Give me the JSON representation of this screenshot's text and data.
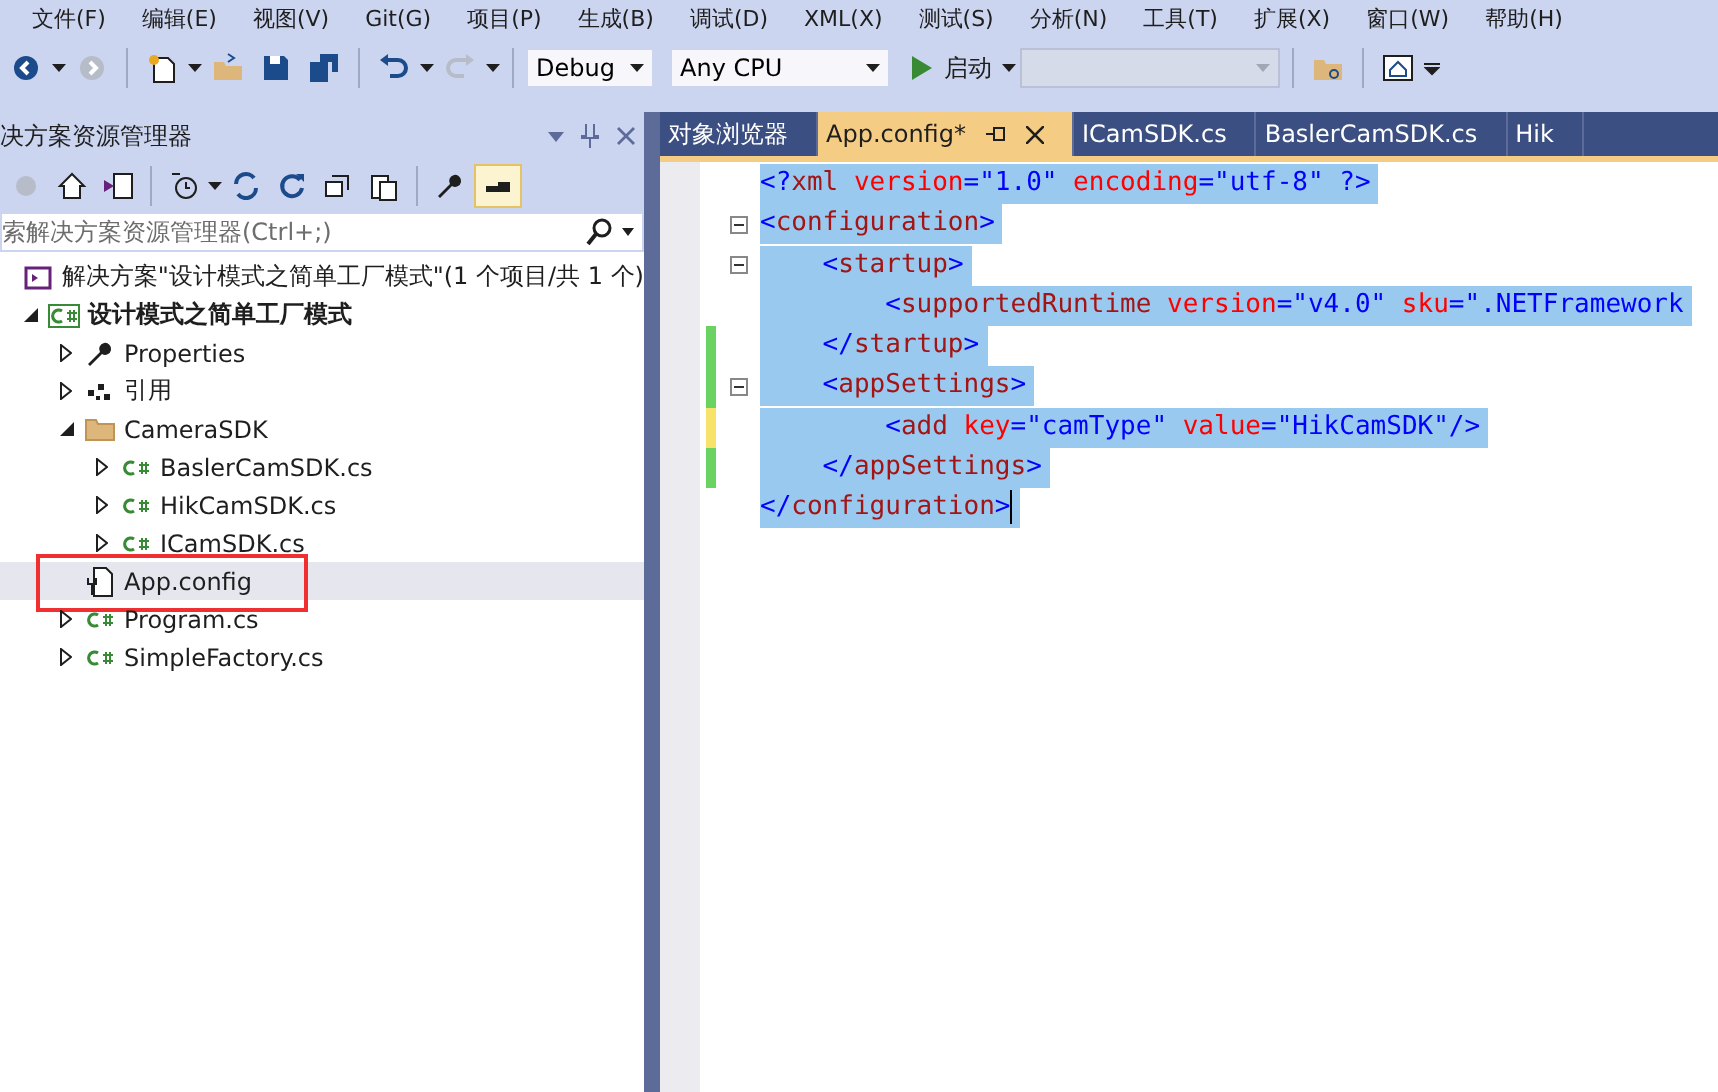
{
  "menu": [
    "文件(F)",
    "编辑(E)",
    "视图(V)",
    "Git(G)",
    "项目(P)",
    "生成(B)",
    "调试(D)",
    "XML(X)",
    "测试(S)",
    "分析(N)",
    "工具(T)",
    "扩展(X)",
    "窗口(W)",
    "帮助(H)"
  ],
  "toolbar": {
    "configuration": "Debug",
    "platform": "Any CPU",
    "start": "启动",
    "target": {
      "disabled": true
    }
  },
  "explorer": {
    "title": "决方案资源管理器",
    "search": {
      "placeholder": "索解决方案资源管理器(Ctrl+;)"
    },
    "tree": [
      {
        "label": "解决方案\"设计模式之简单工厂模式\"(1 个项目/共 1 个)",
        "kind": "solution",
        "selected": false,
        "children": [
          {
            "label": "设计模式之简单工厂模式",
            "kind": "project",
            "expanded": true,
            "selected": false,
            "children": [
              {
                "label": "Properties",
                "kind": "properties",
                "expanded": false,
                "selected": false
              },
              {
                "label": "引用",
                "kind": "references",
                "expanded": false,
                "selected": false
              },
              {
                "label": "CameraSDK",
                "kind": "folder",
                "expanded": true,
                "selected": false,
                "children": [
                  {
                    "label": "BaslerCamSDK.cs",
                    "kind": "cs",
                    "expanded": false,
                    "selected": false
                  },
                  {
                    "label": "HikCamSDK.cs",
                    "kind": "cs",
                    "expanded": false,
                    "selected": false
                  },
                  {
                    "label": "ICamSDK.cs",
                    "kind": "cs",
                    "expanded": false,
                    "selected": false
                  }
                ]
              },
              {
                "label": "App.config",
                "kind": "config",
                "selected": true,
                "highlighted": true
              },
              {
                "label": "Program.cs",
                "kind": "cs",
                "expanded": false,
                "selected": false
              },
              {
                "label": "SimpleFactory.cs",
                "kind": "cs",
                "expanded": false,
                "selected": false
              }
            ]
          }
        ]
      }
    ]
  },
  "tabs": [
    {
      "label": "对象浏览器",
      "selected": false
    },
    {
      "label": "App.config*",
      "selected": true
    },
    {
      "label": "ICamSDK.cs",
      "selected": false
    },
    {
      "label": "BaslerCamSDK.cs",
      "selected": false
    },
    {
      "label": "Hik",
      "selected": false
    }
  ],
  "editor": {
    "lines": [
      {
        "fold": false,
        "modified": false,
        "tokens": [
          {
            "kind": "punct",
            "text": "<?"
          },
          {
            "kind": "tag",
            "text": "xml"
          },
          {
            "kind": "attr",
            "text": " version"
          },
          {
            "kind": "punct",
            "text": "=\"1.0\""
          },
          {
            "kind": "attr",
            "text": " encoding"
          },
          {
            "kind": "punct",
            "text": "=\"utf-8\" ?>"
          }
        ]
      },
      {
        "fold": true,
        "modified": false,
        "tokens": [
          {
            "kind": "punct",
            "text": "<"
          },
          {
            "kind": "tag",
            "text": "configuration"
          },
          {
            "kind": "punct",
            "text": ">"
          }
        ]
      },
      {
        "fold": true,
        "modified": false,
        "tokens": [
          {
            "kind": "punct",
            "text": "    <"
          },
          {
            "kind": "tag",
            "text": "startup"
          },
          {
            "kind": "punct",
            "text": ">"
          }
        ]
      },
      {
        "fold": false,
        "modified": false,
        "tokens": [
          {
            "kind": "punct",
            "text": "        <"
          },
          {
            "kind": "tag",
            "text": "supportedRuntime"
          },
          {
            "kind": "attr",
            "text": " version"
          },
          {
            "kind": "punct",
            "text": "=\"v4.0\""
          },
          {
            "kind": "attr",
            "text": " sku"
          },
          {
            "kind": "punct",
            "text": "=\".NETFramework"
          }
        ]
      },
      {
        "fold": false,
        "modified": true,
        "saved": true,
        "tokens": [
          {
            "kind": "punct",
            "text": "    </"
          },
          {
            "kind": "tag",
            "text": "startup"
          },
          {
            "kind": "punct",
            "text": ">"
          }
        ]
      },
      {
        "fold": true,
        "modified": true,
        "saved": true,
        "tokens": [
          {
            "kind": "punct",
            "text": "    <"
          },
          {
            "kind": "tag",
            "text": "appSettings"
          },
          {
            "kind": "punct",
            "text": ">"
          }
        ]
      },
      {
        "fold": false,
        "modified": true,
        "saved": false,
        "tokens": [
          {
            "kind": "punct",
            "text": "        <"
          },
          {
            "kind": "tag",
            "text": "add"
          },
          {
            "kind": "attr",
            "text": " key"
          },
          {
            "kind": "punct",
            "text": "=\"camType\""
          },
          {
            "kind": "attr",
            "text": " value"
          },
          {
            "kind": "punct",
            "text": "=\"HikCamSDK\"/>"
          }
        ]
      },
      {
        "fold": false,
        "modified": true,
        "saved": true,
        "tokens": [
          {
            "kind": "punct",
            "text": "    </"
          },
          {
            "kind": "tag",
            "text": "appSettings"
          },
          {
            "kind": "punct",
            "text": ">"
          }
        ]
      },
      {
        "fold": false,
        "modified": false,
        "cursor": true,
        "tokens": [
          {
            "kind": "punct",
            "text": "</"
          },
          {
            "kind": "tag",
            "text": "configuration"
          },
          {
            "kind": "punct",
            "text": ">"
          }
        ]
      }
    ]
  }
}
